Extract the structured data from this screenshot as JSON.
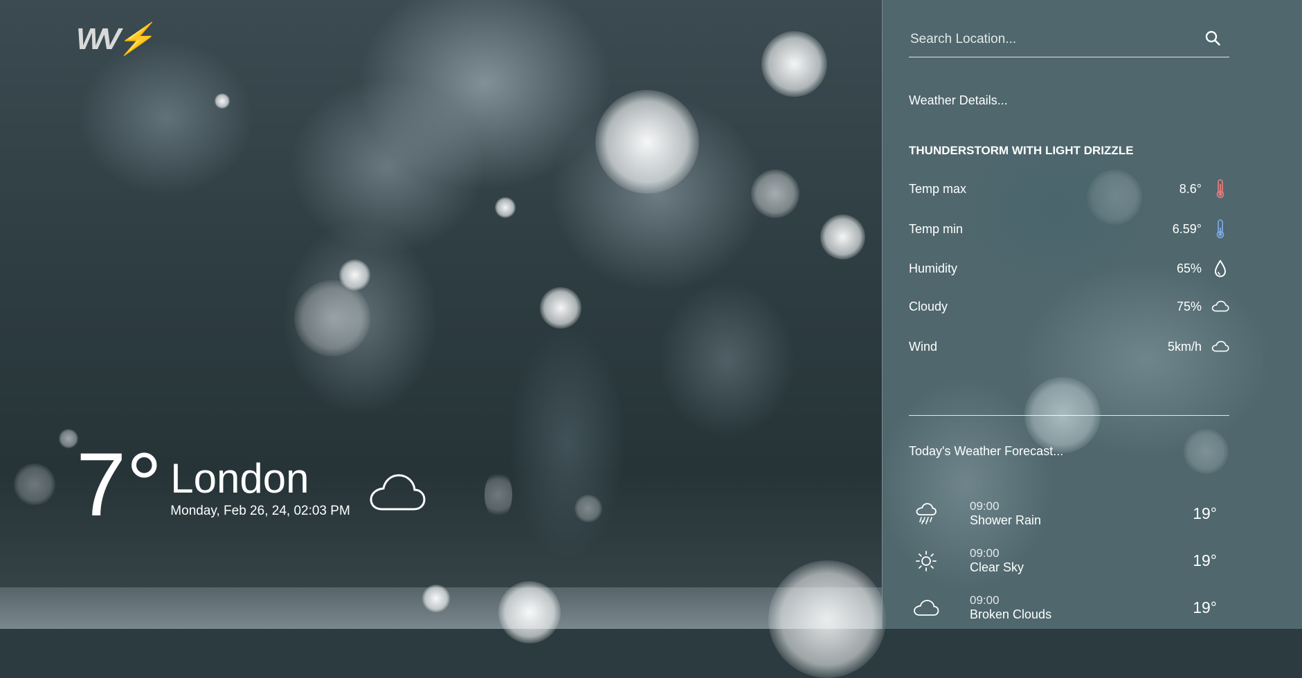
{
  "brand": {
    "logo_text": "WV",
    "logo_bolt": "⚡"
  },
  "current": {
    "temperature": "7°",
    "city": "London",
    "datetime": "Monday, Feb 26, 24, 02:03 PM",
    "icon": "cloud-icon"
  },
  "search": {
    "placeholder": "Search Location...",
    "icon": "search-icon"
  },
  "details": {
    "heading": "Weather Details...",
    "condition": "THUNDERSTORM WITH LIGHT DRIZZLE",
    "rows": [
      {
        "label": "Temp max",
        "value": "8.6°",
        "icon": "thermometer-hot-icon"
      },
      {
        "label": "Temp min",
        "value": "6.59°",
        "icon": "thermometer-cold-icon"
      },
      {
        "label": "Humidity",
        "value": "65%",
        "icon": "droplet-icon"
      },
      {
        "label": "Cloudy",
        "value": "75%",
        "icon": "cloud-icon"
      },
      {
        "label": "Wind",
        "value": "5km/h",
        "icon": "cloud-icon"
      }
    ]
  },
  "forecast": {
    "heading": "Today's Weather Forecast...",
    "items": [
      {
        "time": "09:00",
        "desc": "Shower Rain",
        "temp": "19°",
        "icon": "rain-icon"
      },
      {
        "time": "09:00",
        "desc": "Clear Sky",
        "temp": "19°",
        "icon": "sun-icon"
      },
      {
        "time": "09:00",
        "desc": "Broken Clouds",
        "temp": "19°",
        "icon": "cloud-icon"
      }
    ]
  },
  "colors": {
    "thermo_hot": "#e07a7a",
    "thermo_cold": "#7aa6e0",
    "logo_accent": "#f2b53a"
  }
}
